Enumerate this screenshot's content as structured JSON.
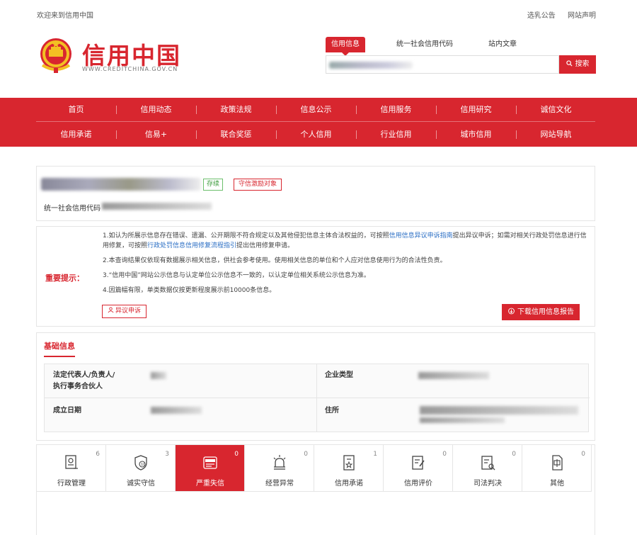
{
  "topbar": {
    "welcome": "欢迎来到信用中国",
    "links": [
      "选乳公告",
      "网站声明"
    ]
  },
  "header": {
    "logo_title": "信用中国",
    "logo_url": "WWW.CREDITCHINA.GOV.CN"
  },
  "search": {
    "tabs": [
      "信用信息",
      "统一社会信用代码",
      "站内文章"
    ],
    "active_tab": 0,
    "button_label": "搜索"
  },
  "nav": {
    "row1": [
      "首页",
      "信用动态",
      "政策法规",
      "信息公示",
      "信用服务",
      "信用研究",
      "诚信文化"
    ],
    "row2": [
      "信用承诺",
      "信易+",
      "联合奖惩",
      "个人信用",
      "行业信用",
      "城市信用",
      "网站导航"
    ]
  },
  "company": {
    "status_tag": "存续",
    "reward_tag": "守信激励对象",
    "uscc_label": "统一社会信用代码"
  },
  "notice": {
    "title": "重要提示：",
    "line1a": "1.如认为所展示信息存在错误、遗漏、公开期限不符合规定以及其他侵犯信息主体合法权益的，可按照",
    "line1link1": "信用信息异议申诉指南",
    "line1b": "提出异议申诉；如需对相关行政处罚信息进行信用修复，可按照",
    "line1link2": "行政处罚信息信用修复流程指引",
    "line1c": "提出信用修复申请。",
    "line2": "2.本查询结果仅依现有数据展示相关信息，供社会参考使用。使用相关信息的单位和个人应对信息使用行为的合法性负责。",
    "line3": "3.“信用中国”网站公示信息与认定单位公示信息不一致的，以认定单位相关系统公示信息为准。",
    "line4": "4.因篇幅有限，单类数据仅按更新程度展示前10000条信息。",
    "objection_button": "异议申诉",
    "download_button": "下载信用信息报告"
  },
  "basic_info": {
    "title": "基础信息",
    "legal_rep_label_1": "法定代表人/负责人/",
    "legal_rep_label_2": "执行事务合伙人",
    "company_type_label": "企业类型",
    "established_label": "成立日期",
    "address_label": "住所"
  },
  "tabs": [
    {
      "label": "行政管理",
      "count": "6",
      "icon": "admin-doc-icon"
    },
    {
      "label": "诚实守信",
      "count": "3",
      "icon": "shield-icon"
    },
    {
      "label": "严重失信",
      "count": "0",
      "icon": "blacklist-icon"
    },
    {
      "label": "经营异常",
      "count": "0",
      "icon": "alarm-icon"
    },
    {
      "label": "信用承诺",
      "count": "1",
      "icon": "commitment-icon"
    },
    {
      "label": "信用评价",
      "count": "0",
      "icon": "evaluation-icon"
    },
    {
      "label": "司法判决",
      "count": "0",
      "icon": "judgment-icon"
    },
    {
      "label": "其他",
      "count": "0",
      "icon": "other-doc-icon"
    }
  ],
  "active_tab": 2,
  "colors": {
    "brand_red": "#d8262f",
    "link_blue": "#2a6ec4",
    "status_green": "#3a9a3a"
  }
}
